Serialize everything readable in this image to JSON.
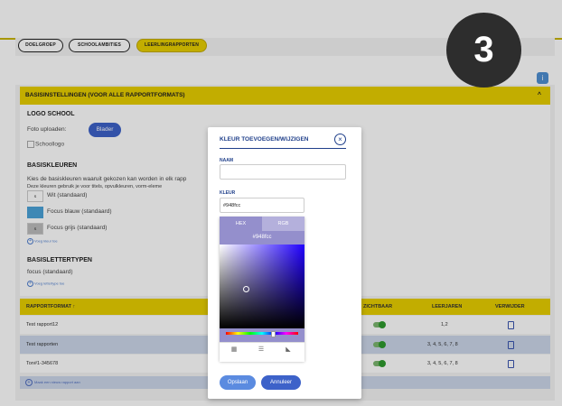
{
  "tabs": [
    {
      "label": "DOELGROEP",
      "active": false
    },
    {
      "label": "SCHOOLAMBITIES",
      "active": false
    },
    {
      "label": "LEERLINGRAPPORTEN",
      "active": true
    }
  ],
  "step_badge": "3",
  "help_icon": "info-icon",
  "section": {
    "title": "BASISINSTELLINGEN (VOOR ALLE RAPPORTFORMATS)",
    "chevron": "^"
  },
  "logo": {
    "heading": "LOGO SCHOOL",
    "upload_label": "Foto uploaden:",
    "browse_button": "Blader",
    "image_alt": "Schoollogo"
  },
  "colors": {
    "heading": "BASISKLEUREN",
    "description_1": "Kies de basiskleuren waaruit gekozen kan worden in elk rapp",
    "description_2": "Deze kleuren gebruik je voor titels, opvulkleuren, vorm-eleme",
    "items": [
      {
        "swatch_text": "S",
        "label": "Wit (standaard)",
        "swatch_color": "#ffffff"
      },
      {
        "swatch_text": "",
        "label": "Focus blauw (standaard)",
        "swatch_color": "#4aa3d8"
      },
      {
        "swatch_text": "S",
        "label": "Focus grijs (standaard)",
        "swatch_color": "#bdbdbd"
      }
    ],
    "add_link": "Voeg kleur toe"
  },
  "fonts": {
    "heading": "BASISLETTERTYPEN",
    "item": "focus (standaard)",
    "add_link": "Voeg lettertype toe"
  },
  "table": {
    "headers": [
      "RAPPORTFORMAT ↑",
      "ZICHTBAAR",
      "LEERJAREN",
      "VERWIJDER"
    ],
    "rows": [
      {
        "name": "Test rapport12",
        "years": "1,2"
      },
      {
        "name": "Test rapporten",
        "years": "3, 4, 5, 6, 7, 8"
      },
      {
        "name": "Ton#1-345678",
        "years": "3, 4, 5, 6, 7, 8"
      }
    ],
    "add_row": "Maak een nieuw rapport aan"
  },
  "modal": {
    "title": "KLEUR TOEVOEGEN/WIJZIGEN",
    "name_label": "NAAM",
    "name_value": "",
    "color_label": "KLEUR",
    "color_value": "#948fcc",
    "picker": {
      "tab_hex": "HEX",
      "tab_rgb": "RGB",
      "hex_value": "#948fcc",
      "tools": [
        "palette-icon",
        "sliders-icon",
        "eyedropper-icon"
      ]
    },
    "save_button": "Opslaan",
    "cancel_button": "Annuleer"
  },
  "palette": {
    "accent_yellow": "#e8cf00",
    "primary_blue": "#3d62c9",
    "picked_color": "#948fcc",
    "toggle_green": "#2e9a2e"
  }
}
